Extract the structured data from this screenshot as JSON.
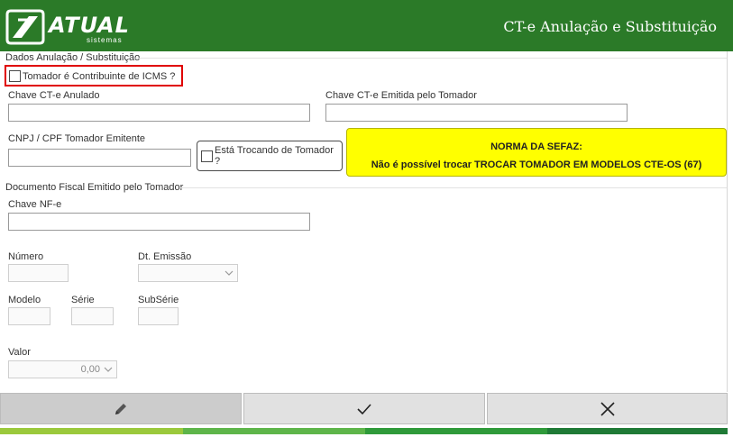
{
  "header": {
    "logo_text": "ATUAL",
    "logo_sub": "sistemas",
    "title": "CT-e Anulação e Substituição"
  },
  "section1": {
    "title": "Dados Anulação / Substituição",
    "contribuinte_label": "Tomador é Contribuinte de ICMS ?",
    "contribuinte_checked": false,
    "chave_anulado_label": "Chave CT-e Anulado",
    "chave_anulado_value": "",
    "chave_emitida_label": "Chave CT-e Emitida pelo Tomador",
    "chave_emitida_value": "",
    "cnpj_label": "CNPJ / CPF Tomador Emitente",
    "cnpj_value": "",
    "trocando_label": "Está Trocando de Tomador ?",
    "trocando_checked": false
  },
  "notice": {
    "title": "NORMA DA SEFAZ:",
    "text": "Não é possível trocar TROCAR TOMADOR EM MODELOS CTE-OS (67)"
  },
  "section2": {
    "title": "Documento Fiscal Emitido pelo Tomador",
    "chave_nfe_label": "Chave NF-e",
    "chave_nfe_value": "",
    "numero_label": "Número",
    "numero_value": "",
    "dt_emissao_label": "Dt. Emissão",
    "dt_emissao_value": "",
    "modelo_label": "Modelo",
    "modelo_value": "",
    "serie_label": "Série",
    "serie_value": "",
    "subserie_label": "SubSérie",
    "subserie_value": "",
    "valor_label": "Valor",
    "valor_value": "0,00"
  },
  "colors": {
    "header": "#2b7a28",
    "notice_bg": "#ffff00",
    "highlight": "#e00000",
    "bar1": "#9bc93c",
    "bar2": "#5eb54a",
    "bar3": "#2f9a3a",
    "bar4": "#1f7a36"
  },
  "icons": {
    "edit": "pencil-icon",
    "confirm": "check-icon",
    "cancel": "close-icon"
  }
}
